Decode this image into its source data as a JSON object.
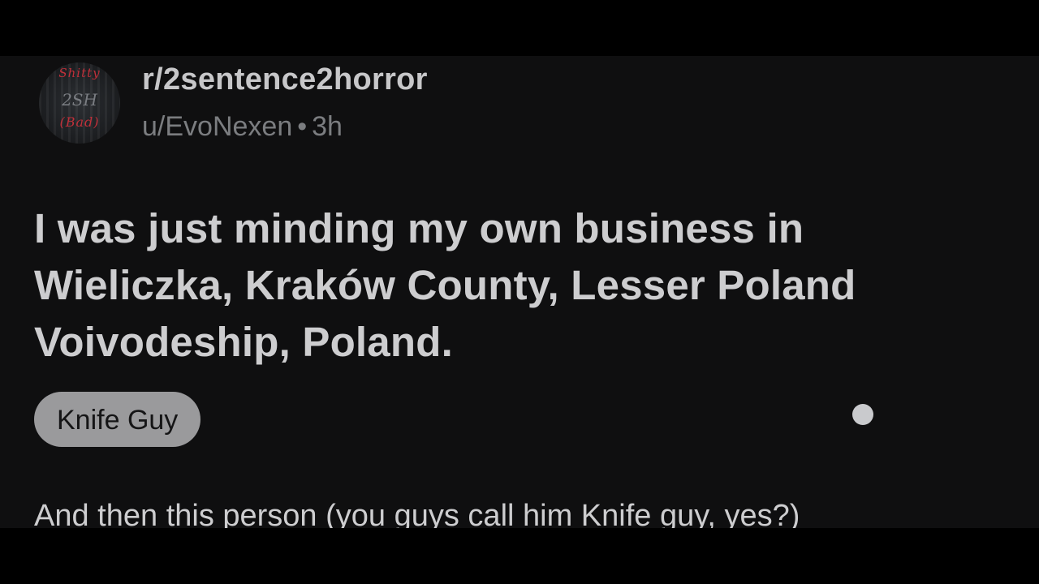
{
  "post": {
    "subreddit": "r/2sentence2horror",
    "author": "u/EvoNexen",
    "separator": "•",
    "age": "3h",
    "title": "I was just minding my own business in Wieliczka, Kraków County, Lesser Poland Voivodeship, Poland.",
    "flair": "Knife Guy",
    "body_preview": "And then this person (you guys call him Knife guy, yes?)"
  },
  "avatar": {
    "icon": "subreddit-avatar",
    "text_top": "Shitty",
    "text_middle": "2SH",
    "text_bottom": "(Bad)"
  },
  "colors": {
    "background": "#0f0f10",
    "letterbox": "#000000",
    "text_primary": "#cdcdcf",
    "text_secondary": "#7b7d80",
    "flair_bg": "#9a9a9c",
    "avatar_accent": "#c0303a"
  }
}
